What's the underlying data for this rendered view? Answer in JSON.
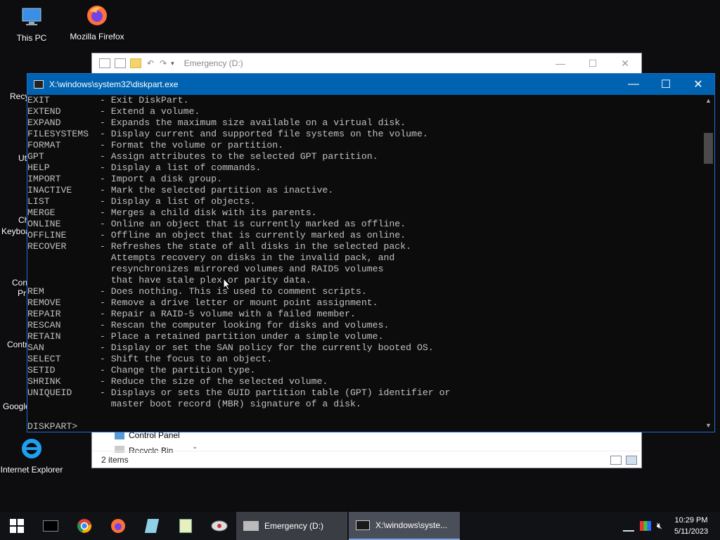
{
  "desktop": {
    "icons": [
      {
        "label": "This PC",
        "icon": "this-pc-icon"
      },
      {
        "label": "Mozilla Firefox",
        "icon": "firefox-icon"
      },
      {
        "label": "Internet Explorer",
        "icon": "internet-explorer-icon"
      }
    ],
    "partial_labels": [
      "Recy",
      "Ut",
      "Ch",
      "Keyboa",
      "Con",
      "Pr",
      "Contr",
      "Google"
    ]
  },
  "explorer": {
    "title": "Emergency (D:)",
    "nav_items": [
      "Control Panel",
      "Recycle Bin"
    ],
    "status": "2 items"
  },
  "console": {
    "title": "X:\\windows\\system32\\diskpart.exe",
    "lines": [
      "EXIT         - Exit DiskPart.",
      "EXTEND       - Extend a volume.",
      "EXPAND       - Expands the maximum size available on a virtual disk.",
      "FILESYSTEMS  - Display current and supported file systems on the volume.",
      "FORMAT       - Format the volume or partition.",
      "GPT          - Assign attributes to the selected GPT partition.",
      "HELP         - Display a list of commands.",
      "IMPORT       - Import a disk group.",
      "INACTIVE     - Mark the selected partition as inactive.",
      "LIST         - Display a list of objects.",
      "MERGE        - Merges a child disk with its parents.",
      "ONLINE       - Online an object that is currently marked as offline.",
      "OFFLINE      - Offline an object that is currently marked as online.",
      "RECOVER      - Refreshes the state of all disks in the selected pack.",
      "               Attempts recovery on disks in the invalid pack, and",
      "               resynchronizes mirrored volumes and RAID5 volumes",
      "               that have stale plex or parity data.",
      "REM          - Does nothing. This is used to comment scripts.",
      "REMOVE       - Remove a drive letter or mount point assignment.",
      "REPAIR       - Repair a RAID-5 volume with a failed member.",
      "RESCAN       - Rescan the computer looking for disks and volumes.",
      "RETAIN       - Place a retained partition under a simple volume.",
      "SAN          - Display or set the SAN policy for the currently booted OS.",
      "SELECT       - Shift the focus to an object.",
      "SETID        - Change the partition type.",
      "SHRINK       - Reduce the size of the selected volume.",
      "UNIQUEID     - Displays or sets the GUID partition table (GPT) identifier or",
      "               master boot record (MBR) signature of a disk.",
      "",
      "DISKPART>"
    ]
  },
  "taskbar": {
    "tasks": [
      {
        "label": "Emergency (D:)",
        "icon": "drive-icon"
      },
      {
        "label": "X:\\windows\\syste...",
        "icon": "console-icon"
      }
    ],
    "clock": {
      "time": "10:29 PM",
      "date": "5/11/2023"
    }
  },
  "colors": {
    "console_title": "#0063b1",
    "console_bg": "#0c0c0c",
    "console_text": "#c0c0c0",
    "taskbar": "#101216"
  }
}
